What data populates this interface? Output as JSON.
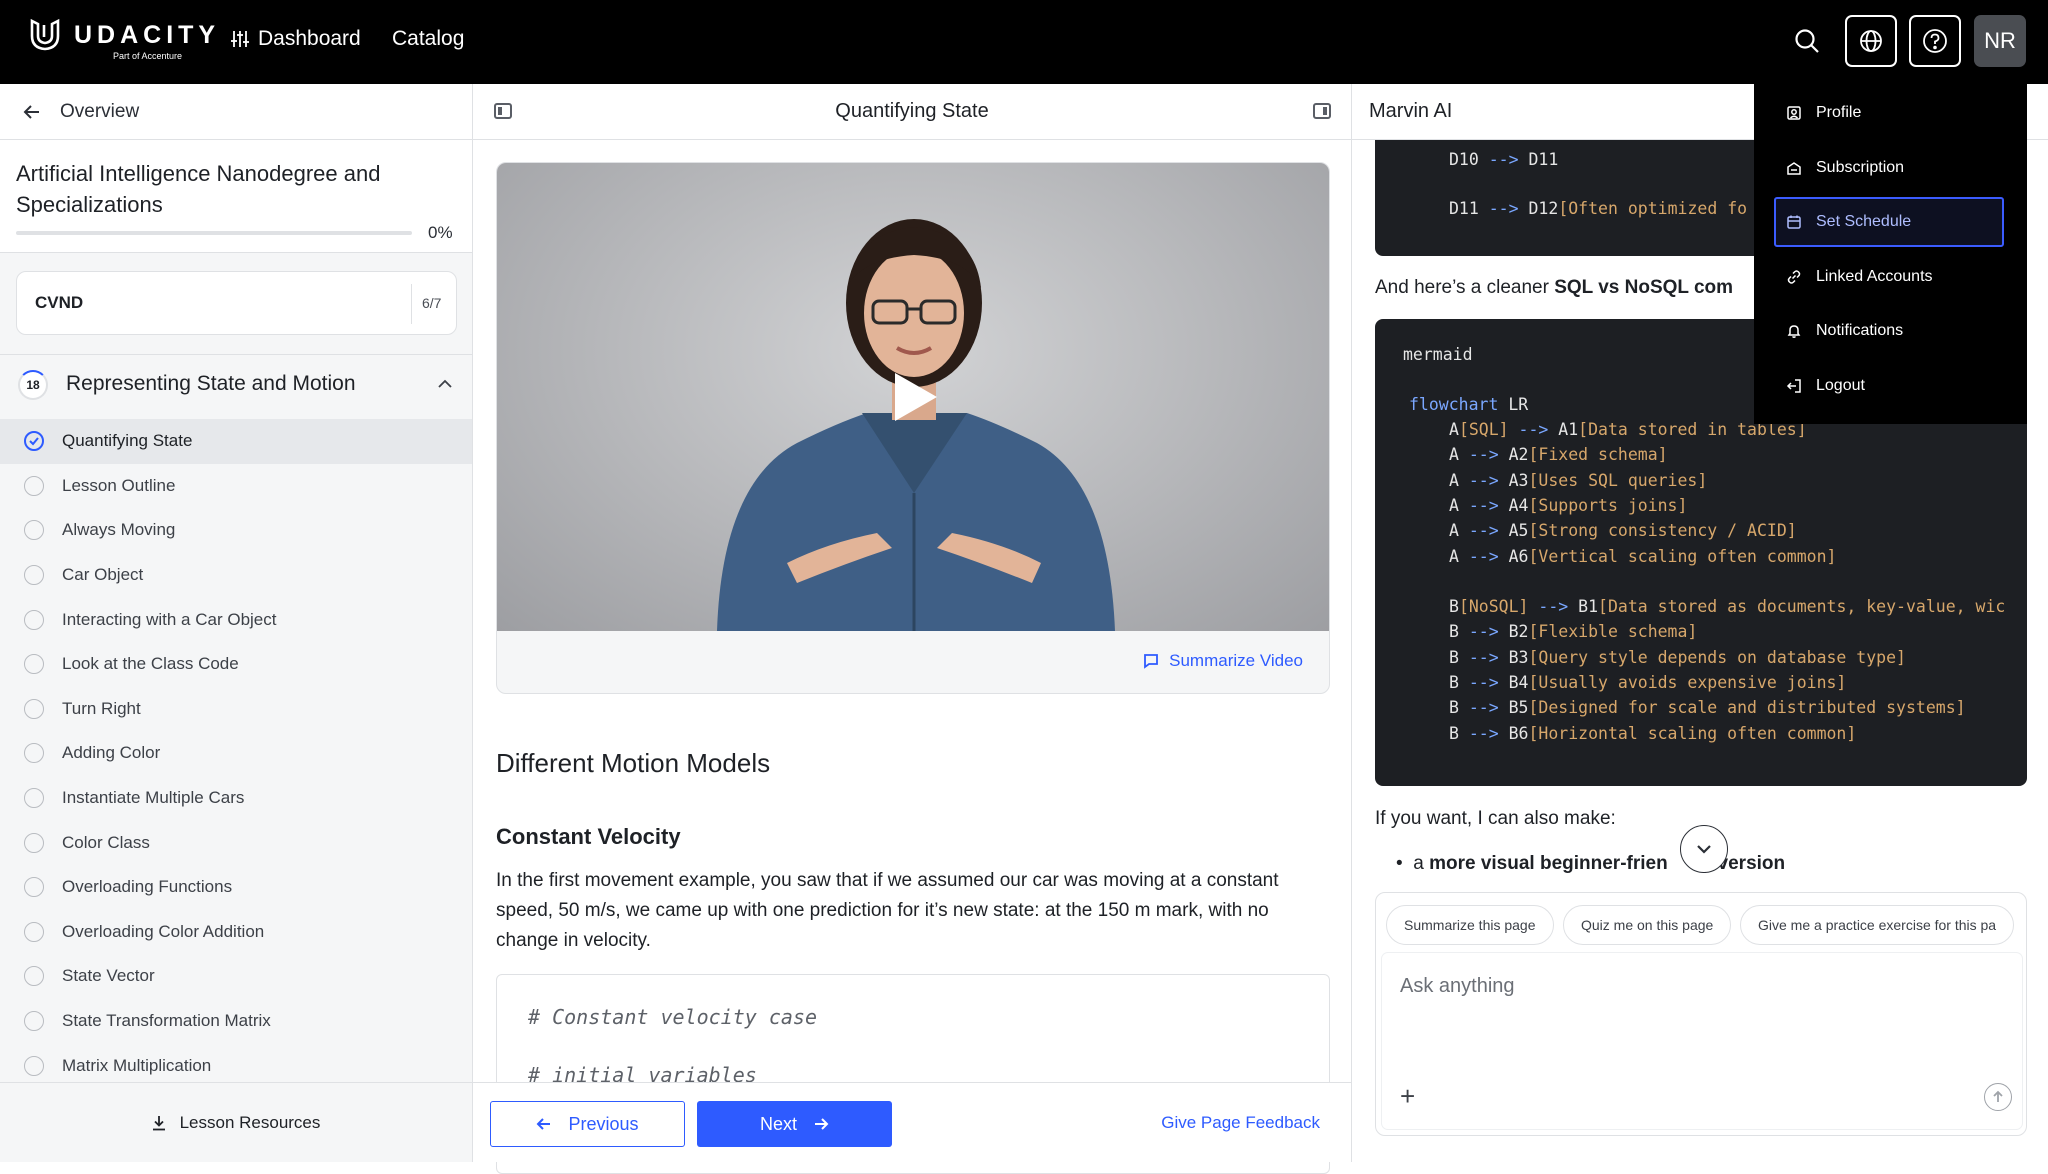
{
  "topbar": {
    "logo_text": "UDACITY",
    "logo_sub": "Part of Accenture",
    "nav": [
      {
        "label": "Dashboard",
        "icon": "sliders-icon"
      },
      {
        "label": "Catalog"
      }
    ],
    "avatar_initials": "NR"
  },
  "sidebar": {
    "overview_label": "Overview",
    "course_title": "Artificial Intelligence Nanodegree and Specializations",
    "progress_text": "0%",
    "progress_fraction": 0,
    "module": {
      "label": "CVND",
      "count": "6/7"
    },
    "lesson": {
      "number": "18",
      "title": "Representing State and Motion"
    },
    "items": [
      {
        "label": "Quantifying State",
        "done": true
      },
      {
        "label": "Lesson Outline"
      },
      {
        "label": "Always Moving"
      },
      {
        "label": "Car Object"
      },
      {
        "label": "Interacting with a Car Object"
      },
      {
        "label": "Look at the Class Code"
      },
      {
        "label": "Turn Right"
      },
      {
        "label": "Adding Color"
      },
      {
        "label": "Instantiate Multiple Cars"
      },
      {
        "label": "Color Class"
      },
      {
        "label": "Overloading Functions"
      },
      {
        "label": "Overloading Color Addition"
      },
      {
        "label": "State Vector"
      },
      {
        "label": "State Transformation Matrix"
      },
      {
        "label": "Matrix Multiplication"
      }
    ],
    "footer_label": "Lesson Resources"
  },
  "center": {
    "title": "Quantifying State",
    "summarize_video": "Summarize Video",
    "heading": "Different Motion Models",
    "subheading": "Constant Velocity",
    "paragraph": "In the first movement example, you saw that if we assumed our car was moving at a constant speed, 50 m/s, we came up with one prediction for it’s new state: at the 150 m mark, with no change in velocity.",
    "code_lines": [
      "# Constant velocity case",
      "# initial variables"
    ],
    "prev_label": "Previous",
    "next_label": "Next",
    "feedback_label": "Give Page Feedback"
  },
  "marvin": {
    "title": "Marvin AI",
    "code1_lines": [
      {
        "a": "D10 ",
        "op": "-->",
        "b": " D11",
        "s": ""
      },
      {
        "a": "D11 ",
        "op": "-->",
        "b": " D12",
        "s": "[Often optimized fo"
      }
    ],
    "cleaner_text_a": "And here’s a cleaner ",
    "cleaner_text_b": "SQL vs NoSQL com",
    "code2": {
      "lang": "mermaid",
      "flowchart": "flowchart",
      "dir": " LR",
      "lines": [
        {
          "a": "A",
          "sa": "[SQL]",
          "op": " --> ",
          "b": "A1",
          "s": "[Data stored in tables]"
        },
        {
          "a": "A",
          "sa": "",
          "op": " --> ",
          "b": "A2",
          "s": "[Fixed schema]"
        },
        {
          "a": "A",
          "sa": "",
          "op": " --> ",
          "b": "A3",
          "s": "[Uses SQL queries]"
        },
        {
          "a": "A",
          "sa": "",
          "op": " --> ",
          "b": "A4",
          "s": "[Supports joins]"
        },
        {
          "a": "A",
          "sa": "",
          "op": " --> ",
          "b": "A5",
          "s": "[Strong consistency / ACID]"
        },
        {
          "a": "A",
          "sa": "",
          "op": " --> ",
          "b": "A6",
          "s": "[Vertical scaling often common]"
        },
        {
          "a": "",
          "sa": "",
          "op": "",
          "b": "",
          "s": ""
        },
        {
          "a": "B",
          "sa": "[NoSQL]",
          "op": " --> ",
          "b": "B1",
          "s": "[Data stored as documents, key-value, wic"
        },
        {
          "a": "B",
          "sa": "",
          "op": " --> ",
          "b": "B2",
          "s": "[Flexible schema]"
        },
        {
          "a": "B",
          "sa": "",
          "op": " --> ",
          "b": "B3",
          "s": "[Query style depends on database type]"
        },
        {
          "a": "B",
          "sa": "",
          "op": " --> ",
          "b": "B4",
          "s": "[Usually avoids expensive joins]"
        },
        {
          "a": "B",
          "sa": "",
          "op": " --> ",
          "b": "B5",
          "s": "[Designed for scale and distributed systems]"
        },
        {
          "a": "B",
          "sa": "",
          "op": " --> ",
          "b": "B6",
          "s": "[Horizontal scaling often common]"
        }
      ]
    },
    "if_you_want": "If you want, I can also make:",
    "bullet_a": "a ",
    "bullet_b": "more visual beginner-frien",
    "bullet_c": "y version",
    "chips": [
      "Summarize this page",
      "Quiz me on this page",
      "Give me a practice exercise for this pa"
    ],
    "ask_placeholder": "Ask anything"
  },
  "menu": {
    "items": [
      {
        "label": "Profile",
        "icon": "profile-icon"
      },
      {
        "label": "Subscription",
        "icon": "subscription-icon"
      },
      {
        "label": "Set Schedule",
        "icon": "calendar-icon",
        "selected": true
      },
      {
        "label": "Linked Accounts",
        "icon": "link-icon"
      },
      {
        "label": "Notifications",
        "icon": "bell-icon"
      },
      {
        "label": "Logout",
        "icon": "logout-icon"
      }
    ]
  },
  "colors": {
    "accent": "#2e5bff",
    "topbar": "#000000",
    "code_bg": "#1d1f23"
  }
}
